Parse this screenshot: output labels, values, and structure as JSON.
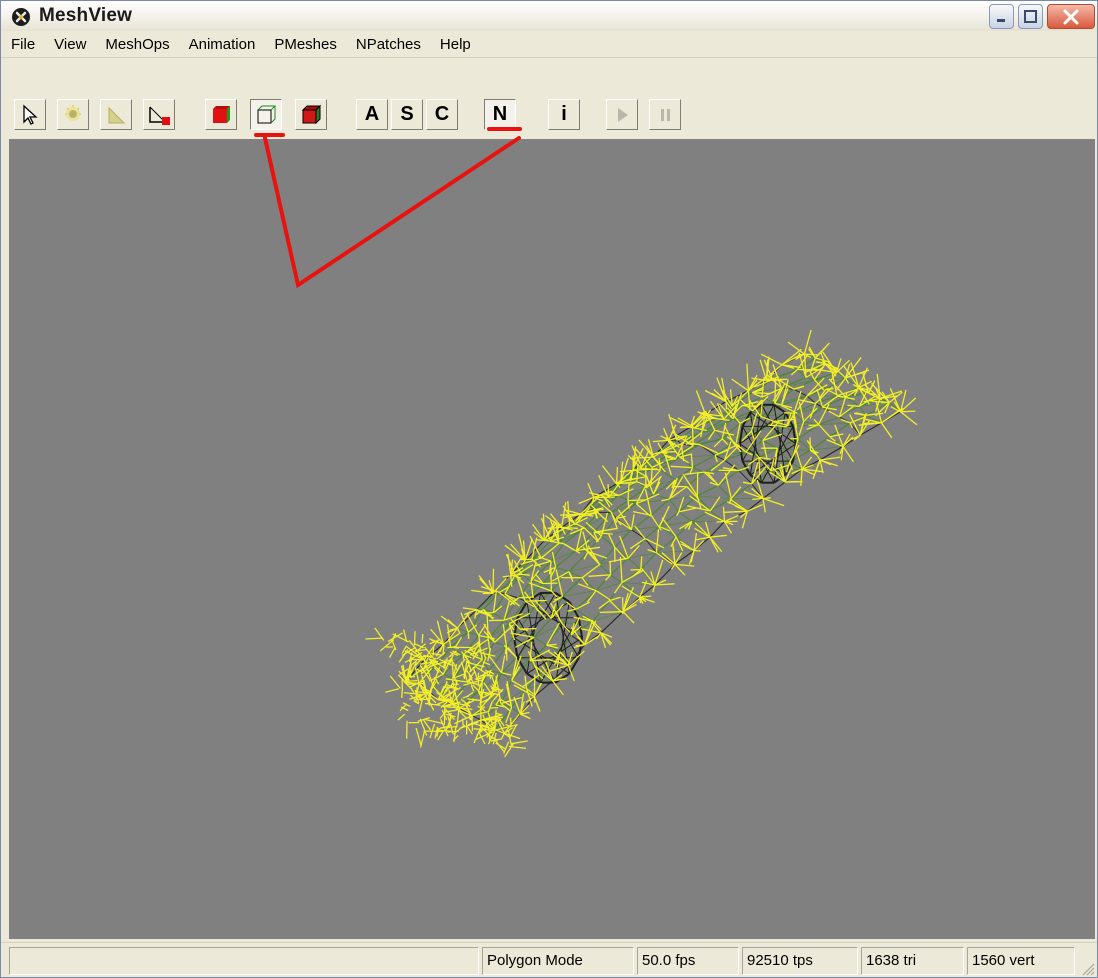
{
  "window": {
    "title": "MeshView",
    "icon": "meshview-app-icon"
  },
  "menu": [
    "File",
    "View",
    "MeshOps",
    "Animation",
    "PMeshes",
    "NPatches",
    "Help"
  ],
  "toolbar": {
    "tools": [
      {
        "id": "select",
        "icon": "arrow-cursor-icon"
      },
      {
        "id": "light",
        "icon": "light-bulb-icon"
      },
      {
        "id": "slope",
        "icon": "slope-icon"
      },
      {
        "id": "slope-red",
        "icon": "slope-red-icon"
      },
      {
        "id": "solid",
        "icon": "solid-cube-icon"
      },
      {
        "id": "wireframe",
        "icon": "wireframe-cube-icon",
        "pressed": true
      },
      {
        "id": "shaded",
        "icon": "shaded-cube-icon"
      },
      {
        "id": "a",
        "label": "A"
      },
      {
        "id": "s",
        "label": "S"
      },
      {
        "id": "c",
        "label": "C"
      },
      {
        "id": "n",
        "label": "N",
        "pressed": true
      },
      {
        "id": "info",
        "label": "i"
      },
      {
        "id": "play",
        "icon": "play-icon",
        "disabled": true
      },
      {
        "id": "pause",
        "icon": "pause-icon",
        "disabled": true
      }
    ]
  },
  "status": {
    "mode": "Polygon Mode",
    "fps": "50.0 fps",
    "tps": "92510 tps",
    "tri": "1638 tri",
    "vert": "1560 vert"
  },
  "colors": {
    "viewport_bg": "#808080",
    "annotation": "#e8120e",
    "normals": "#f2ee28",
    "wire": "#1d1f1c",
    "green_edges": "#3f8a26"
  }
}
